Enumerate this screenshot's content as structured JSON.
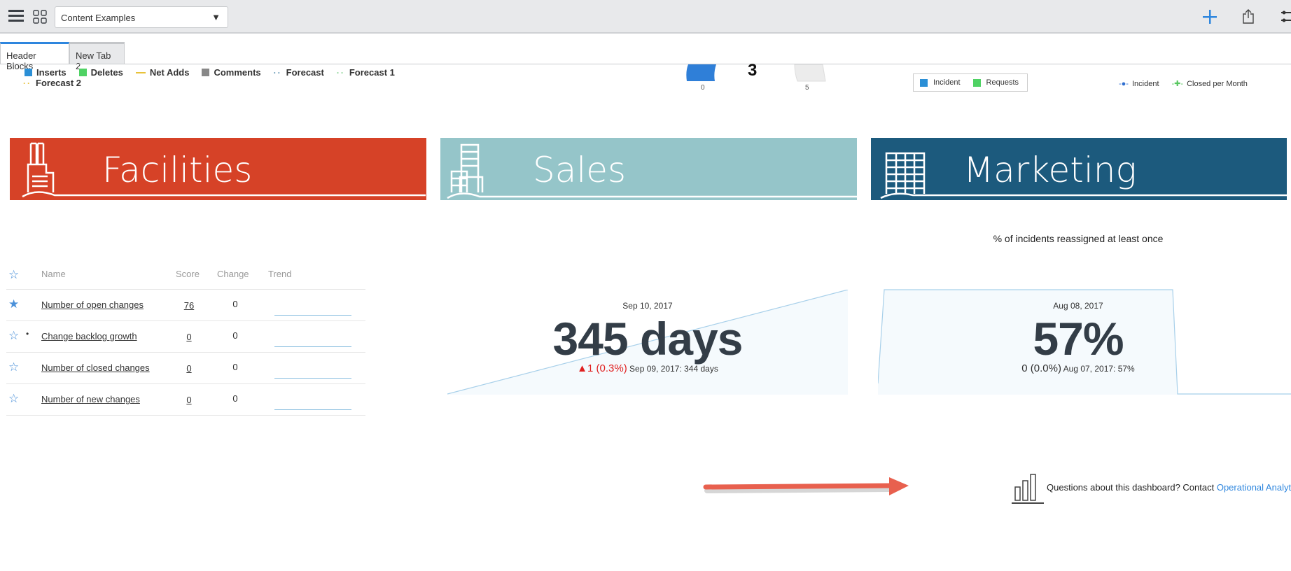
{
  "toolbar": {
    "dashboard_select": "Content Examples",
    "menu_icon": "hamburger-icon",
    "grid_icon": "grid-icon",
    "add_icon": "plus-icon",
    "share_icon": "share-icon",
    "settings_icon": "sliders-icon"
  },
  "tabs": [
    {
      "label": "Header Blocks",
      "active": true
    },
    {
      "label": "New Tab 2",
      "active": false
    }
  ],
  "legend_top": [
    {
      "label": "Inserts",
      "color": "#2b8fd6",
      "type": "square"
    },
    {
      "label": "Deletes",
      "color": "#4fd264",
      "type": "square"
    },
    {
      "label": "Net Adds",
      "color": "#e8c23a",
      "type": "line"
    },
    {
      "label": "Comments",
      "color": "#888888",
      "type": "square"
    },
    {
      "label": "Forecast",
      "color": "#5b8fb0",
      "type": "dots"
    },
    {
      "label": "Forecast 1",
      "color": "#7fd08a",
      "type": "dots"
    },
    {
      "label": "Forecast 2",
      "color": "#e8c23a",
      "type": "dots"
    }
  ],
  "gauge": {
    "value": "3",
    "min": "0",
    "max": "5",
    "fill_fraction": 0.6,
    "color": "#2f7fd8"
  },
  "legend_box": [
    {
      "label": "Incident",
      "color": "#2b8fd6"
    },
    {
      "label": "Requests",
      "color": "#4fd264"
    }
  ],
  "legend_lines": [
    {
      "label": "Incident",
      "color": "#2f6fd0"
    },
    {
      "label": "Closed per Month",
      "color": "#57c75f"
    }
  ],
  "banners": [
    {
      "title": "Facilities",
      "color": "#d64227",
      "icon": "factory-icon"
    },
    {
      "title": "Sales",
      "color": "#95c5c9",
      "icon": "buildings-icon"
    },
    {
      "title": "Marketing",
      "color": "#1c5a7d",
      "icon": "office-building-icon"
    }
  ],
  "table": {
    "headers": {
      "name": "Name",
      "score": "Score",
      "change": "Change",
      "trend": "Trend"
    },
    "rows": [
      {
        "name": "Number of open changes",
        "score": "76",
        "change": "0",
        "starred": true
      },
      {
        "name": "Change backlog growth",
        "score": "0",
        "change": "0",
        "starred": false
      },
      {
        "name": "Number of closed changes",
        "score": "0",
        "change": "0",
        "starred": false
      },
      {
        "name": "Number of new changes",
        "score": "0",
        "change": "0",
        "starred": false
      }
    ]
  },
  "scorecard1": {
    "date": "Sep 10, 2017",
    "value": "345 days",
    "delta": "▲1 (0.3%)",
    "delta_color": "#e02020",
    "previous": "Sep 09, 2017: 344 days"
  },
  "scorecard2": {
    "title": "% of incidents reassigned at least once",
    "date": "Aug 08, 2017",
    "value": "57%",
    "delta": "0 (0.0%)",
    "previous": "Aug 07, 2017: 57%"
  },
  "footer": {
    "text": "Questions about this dashboard? Contact ",
    "link": "Operational Analytics"
  }
}
